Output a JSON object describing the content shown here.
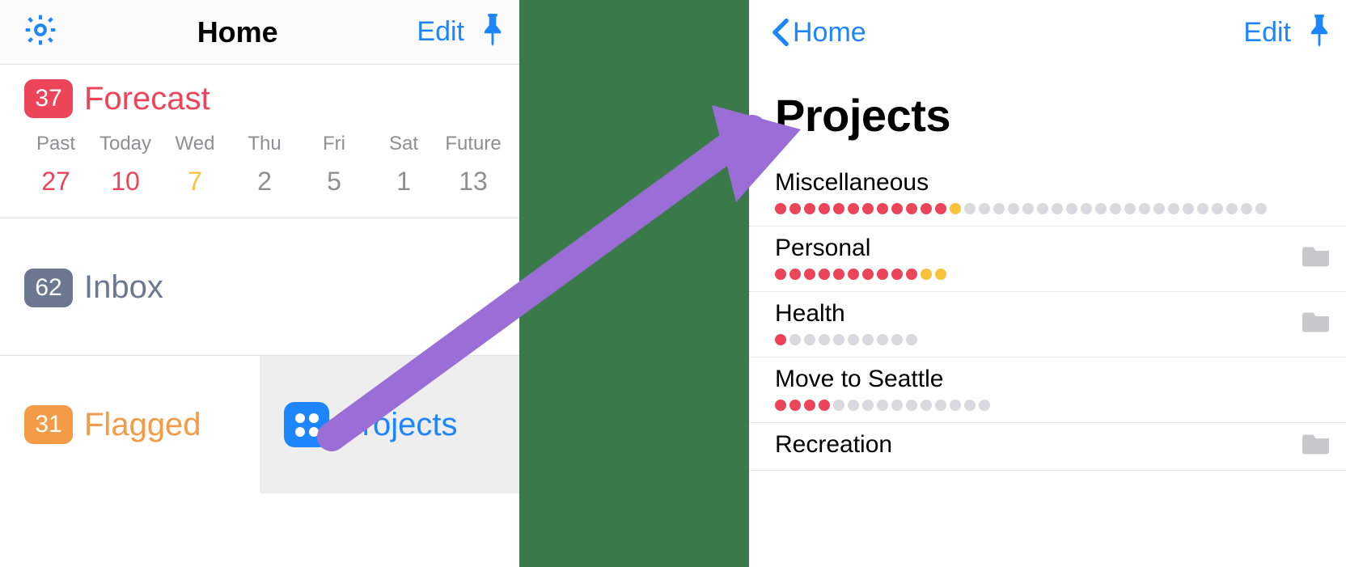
{
  "colors": {
    "blue": "#1d86ff",
    "red": "#ec455a",
    "orange": "#f39b46",
    "amber": "#f8c23b",
    "slate": "#6c7890",
    "grey": "#8e8e93",
    "dotGrey": "#d9d9de",
    "selBg": "#eeeeee"
  },
  "left": {
    "title": "Home",
    "edit": "Edit",
    "forecast": {
      "count": "37",
      "label": "Forecast",
      "badgeColor": "#ec455a",
      "labelColor": "#ec455a"
    },
    "days": [
      {
        "name": "Past",
        "count": "27",
        "color": "#ec455a"
      },
      {
        "name": "Today",
        "count": "10",
        "color": "#ec455a"
      },
      {
        "name": "Wed",
        "count": "7",
        "color": "#f8c23b"
      },
      {
        "name": "Thu",
        "count": "2",
        "color": "#8e8e93"
      },
      {
        "name": "Fri",
        "count": "5",
        "color": "#8e8e93"
      },
      {
        "name": "Sat",
        "count": "1",
        "color": "#8e8e93"
      },
      {
        "name": "Future",
        "count": "13",
        "color": "#8e8e93"
      }
    ],
    "inbox": {
      "count": "62",
      "label": "Inbox",
      "badgeColor": "#6c7890",
      "labelColor": "#6c7890"
    },
    "flagged": {
      "count": "31",
      "label": "Flagged",
      "badgeColor": "#f39b46",
      "labelColor": "#f39b46"
    },
    "projects": {
      "label": "Projects",
      "labelColor": "#1d86ff"
    }
  },
  "right": {
    "backLabel": "Home",
    "edit": "Edit",
    "title": "Projects",
    "items": [
      {
        "name": "Miscellaneous",
        "red": 12,
        "amber": 1,
        "grey": 21,
        "folder": false
      },
      {
        "name": "Personal",
        "red": 10,
        "amber": 2,
        "grey": 0,
        "folder": true
      },
      {
        "name": "Health",
        "red": 1,
        "amber": 0,
        "grey": 9,
        "folder": true
      },
      {
        "name": "Move to Seattle",
        "red": 4,
        "amber": 0,
        "grey": 11,
        "folder": false
      },
      {
        "name": "Recreation",
        "red": 0,
        "amber": 0,
        "grey": 0,
        "folder": true
      }
    ]
  }
}
